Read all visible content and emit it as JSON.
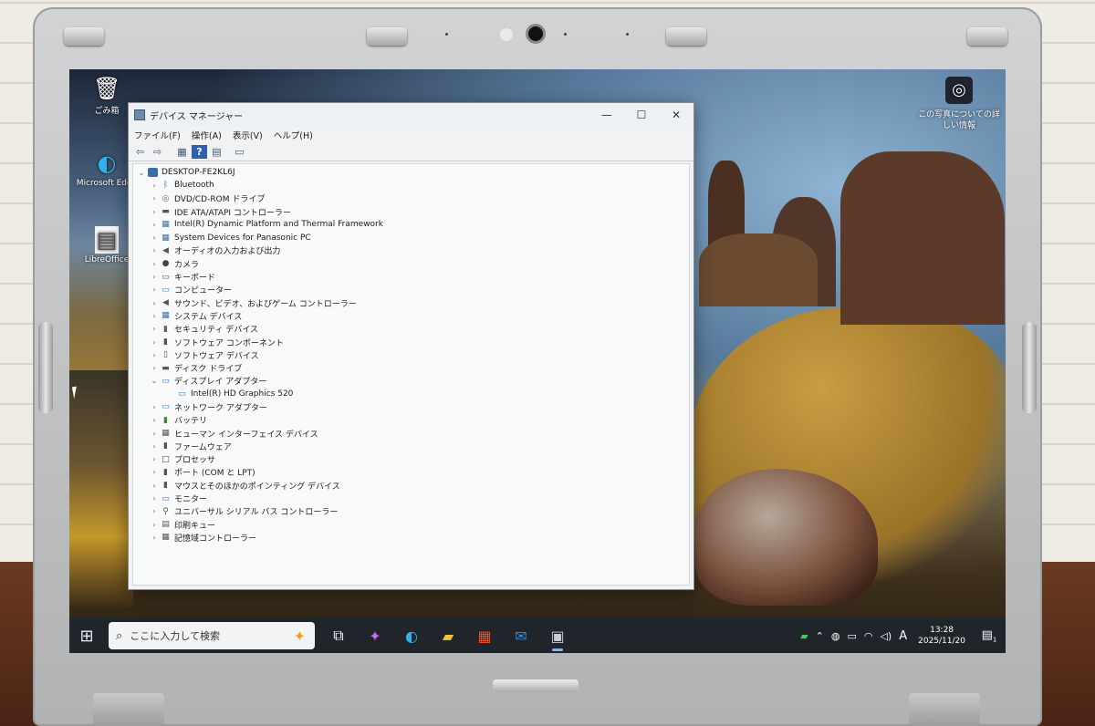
{
  "desktop": {
    "icons": [
      {
        "label": "ごみ箱",
        "icon": "recycle-bin-icon",
        "glyph": "🗑"
      },
      {
        "label": "Microsoft Edge",
        "icon": "edge-icon",
        "glyph": "◐"
      },
      {
        "label": "LibreOffice",
        "icon": "libreoffice-icon",
        "glyph": "▤"
      }
    ],
    "info_text": "この写真についての詳しい情報"
  },
  "window": {
    "title": "デバイス マネージャー",
    "controls": {
      "minimize": "—",
      "maximize": "☐",
      "close": "✕"
    },
    "menu": [
      "ファイル(F)",
      "操作(A)",
      "表示(V)",
      "ヘルプ(H)"
    ],
    "toolbar": [
      {
        "icon": "back-arrow-icon",
        "glyph": "⇦"
      },
      {
        "icon": "forward-arrow-icon",
        "glyph": "⇨"
      },
      {
        "icon": "properties-icon",
        "glyph": "▦"
      },
      {
        "icon": "help-icon",
        "glyph": "?"
      },
      {
        "icon": "view-icon",
        "glyph": "▤"
      },
      {
        "icon": "monitor-icon",
        "glyph": "▭"
      }
    ],
    "tree": {
      "root": "DESKTOP-FE2KL6J",
      "items": [
        {
          "label": "Bluetooth",
          "icon": "bluetooth-icon",
          "glyph": "ᛒ",
          "color": "#1e6fd9",
          "expanded": false
        },
        {
          "label": "DVD/CD-ROM ドライブ",
          "icon": "disc-drive-icon",
          "glyph": "◎",
          "color": "#666",
          "expanded": false
        },
        {
          "label": "IDE ATA/ATAPI コントローラー",
          "icon": "ide-controller-icon",
          "glyph": "▬",
          "color": "#555",
          "expanded": false
        },
        {
          "label": "Intel(R) Dynamic Platform and Thermal Framework",
          "icon": "chip-icon",
          "glyph": "▦",
          "color": "#3b6ea5",
          "expanded": false
        },
        {
          "label": "System Devices for Panasonic PC",
          "icon": "system-device-icon",
          "glyph": "▦",
          "color": "#3b6ea5",
          "expanded": false
        },
        {
          "label": "オーディオの入力および出力",
          "icon": "audio-icon",
          "glyph": "◀",
          "color": "#555",
          "expanded": false
        },
        {
          "label": "カメラ",
          "icon": "camera-icon",
          "glyph": "●",
          "color": "#444",
          "expanded": false
        },
        {
          "label": "キーボード",
          "icon": "keyboard-icon",
          "glyph": "▭",
          "color": "#555",
          "expanded": false
        },
        {
          "label": "コンピューター",
          "icon": "computer-icon",
          "glyph": "▭",
          "color": "#2f7bc4",
          "expanded": false
        },
        {
          "label": "サウンド、ビデオ、およびゲーム コントローラー",
          "icon": "sound-icon",
          "glyph": "◀",
          "color": "#555",
          "expanded": false
        },
        {
          "label": "システム デバイス",
          "icon": "system-devices-icon",
          "glyph": "▦",
          "color": "#3b6ea5",
          "expanded": false
        },
        {
          "label": "セキュリティ デバイス",
          "icon": "security-icon",
          "glyph": "▮",
          "color": "#666",
          "expanded": false
        },
        {
          "label": "ソフトウェア コンポーネント",
          "icon": "software-component-icon",
          "glyph": "▮",
          "color": "#555",
          "expanded": false
        },
        {
          "label": "ソフトウェア デバイス",
          "icon": "software-device-icon",
          "glyph": "▯",
          "color": "#555",
          "expanded": false
        },
        {
          "label": "ディスク ドライブ",
          "icon": "disk-drive-icon",
          "glyph": "▬",
          "color": "#555",
          "expanded": false
        },
        {
          "label": "ディスプレイ アダプター",
          "icon": "display-adapter-icon",
          "glyph": "▭",
          "color": "#2f7bc4",
          "expanded": true
        },
        {
          "label": "Intel(R) HD Graphics 520",
          "icon": "display-adapter-icon",
          "glyph": "▭",
          "color": "#2f7bc4",
          "child": true
        },
        {
          "label": "ネットワーク アダプター",
          "icon": "network-icon",
          "glyph": "▭",
          "color": "#2f7bc4",
          "expanded": false
        },
        {
          "label": "バッテリ",
          "icon": "battery-icon",
          "glyph": "▮",
          "color": "#3a8a3a",
          "expanded": false
        },
        {
          "label": "ヒューマン インターフェイス デバイス",
          "icon": "hid-icon",
          "glyph": "▦",
          "color": "#555",
          "expanded": false
        },
        {
          "label": "ファームウェア",
          "icon": "firmware-icon",
          "glyph": "▮",
          "color": "#555",
          "expanded": false
        },
        {
          "label": "プロセッサ",
          "icon": "processor-icon",
          "glyph": "□",
          "color": "#444",
          "expanded": false
        },
        {
          "label": "ポート (COM と LPT)",
          "icon": "port-icon",
          "glyph": "▮",
          "color": "#555",
          "expanded": false
        },
        {
          "label": "マウスとそのほかのポインティング デバイス",
          "icon": "mouse-icon",
          "glyph": "▮",
          "color": "#555",
          "expanded": false
        },
        {
          "label": "モニター",
          "icon": "monitor-icon",
          "glyph": "▭",
          "color": "#2f7bc4",
          "expanded": false
        },
        {
          "label": "ユニバーサル シリアル バス コントローラー",
          "icon": "usb-icon",
          "glyph": "⚲",
          "color": "#555",
          "expanded": false
        },
        {
          "label": "印刷キュー",
          "icon": "printer-icon",
          "glyph": "▤",
          "color": "#555",
          "expanded": false
        },
        {
          "label": "記憶域コントローラー",
          "icon": "storage-controller-icon",
          "glyph": "▦",
          "color": "#555",
          "expanded": false
        }
      ]
    }
  },
  "taskbar": {
    "search_placeholder": "ここに入力して検索",
    "apps": [
      {
        "name": "task-view",
        "glyph": "⧉",
        "color": "#ffffff"
      },
      {
        "name": "copilot",
        "glyph": "✦",
        "color": "#c36bff"
      },
      {
        "name": "edge",
        "glyph": "◐",
        "color": "#2fb1f0"
      },
      {
        "name": "file-explorer",
        "glyph": "▰",
        "color": "#f3c13a"
      },
      {
        "name": "microsoft-store",
        "glyph": "▦",
        "color": "#f25022"
      },
      {
        "name": "outlook",
        "glyph": "✉",
        "color": "#2f8ee5"
      },
      {
        "name": "device-manager",
        "glyph": "▣",
        "color": "#c8cdd4",
        "active": true
      }
    ],
    "tray": {
      "ime": "A",
      "time": "13:28",
      "date": "2025/11/20",
      "notifications": "1"
    }
  }
}
